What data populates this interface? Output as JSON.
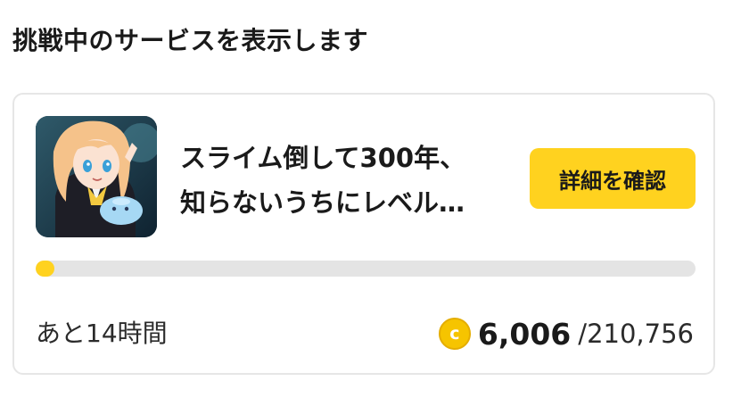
{
  "section": {
    "title": "挑戦中のサービスを表示します"
  },
  "service": {
    "title_line1": "スライム倒して300年、",
    "title_line2": "知らないうちにレベル…",
    "detail_button_label": "詳細を確認",
    "thumbnail_icon": "anime-character-thumbnail"
  },
  "progress": {
    "fraction": 0.0285,
    "fill_color": "#ffd21f",
    "track_color": "#e4e4e4"
  },
  "status": {
    "remaining_time": "あと14時間",
    "coin_icon_glyph": "c",
    "points_current": "6,006",
    "points_separator": "/",
    "points_total": "210,756"
  },
  "colors": {
    "accent": "#ffd21f",
    "coin": "#f6c400"
  }
}
